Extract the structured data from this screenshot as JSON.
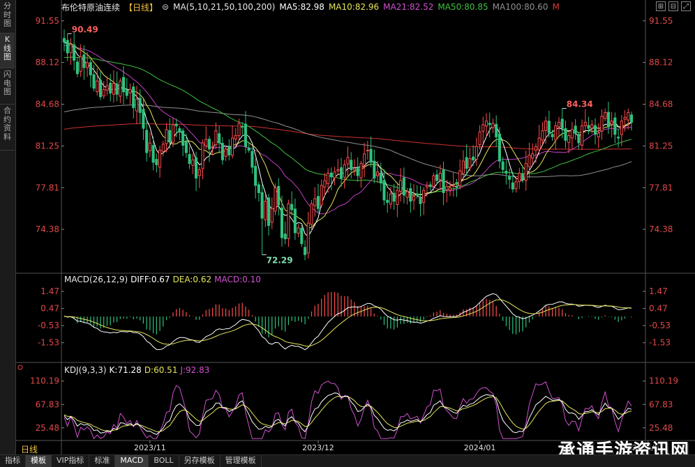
{
  "left_tabs": [
    {
      "label": "分时图",
      "active": false
    },
    {
      "label": "K线图",
      "active": true
    },
    {
      "label": "闪电图",
      "active": false
    },
    {
      "label": "合约资料",
      "active": false
    }
  ],
  "header": {
    "title": "布伦特原油连续",
    "period_tag": "【日线】",
    "ma_params": "MA(5,10,21,50,100,200)",
    "ma5": "MA5:82.98",
    "ma10": "MA10:82.96",
    "ma21": "MA21:82.52",
    "ma50": "MA50:80.85",
    "ma100": "MA100:80.60",
    "more": "M"
  },
  "price_axis_labels": [
    "91.55",
    "88.12",
    "84.68",
    "81.25",
    "77.81",
    "74.38"
  ],
  "macd_legend": {
    "params": "MACD(26,12,9)",
    "diff": "DIFF:0.67",
    "dea": "DEA:0.62",
    "macd": "MACD:0.10"
  },
  "macd_axis_labels": [
    "1.47",
    "0.47",
    "-0.53",
    "-1.53"
  ],
  "kdj_legend": {
    "params": "KDJ(9,3,3)",
    "k": "K:71.28",
    "d": "D:60.51",
    "j": "J:92.83"
  },
  "kdj_axis_labels": [
    "110.19",
    "67.83",
    "25.48"
  ],
  "date_labels": [
    "2023/11",
    "2023/12",
    "2024/01",
    "2024/02"
  ],
  "period_label": "日线",
  "bottom_tabs": [
    {
      "label": "指标",
      "active": false
    },
    {
      "label": "模板",
      "active": true
    },
    {
      "label": "VIP指标",
      "active": false
    },
    {
      "label": "标准",
      "active": false
    },
    {
      "label": "MACD",
      "active": true
    },
    {
      "label": "BOLL",
      "active": false
    },
    {
      "label": "另存模板",
      "active": false
    },
    {
      "label": "管理模板",
      "active": false
    }
  ],
  "watermark": "承通手游资讯网",
  "colors": {
    "up": "#ff4d4d",
    "down": "#2ec27e",
    "axis": "#e04848",
    "ma5": "#ffffff",
    "ma10": "#e6e65a",
    "ma21": "#c040c0",
    "ma50": "#40c040",
    "ma100": "#909090",
    "ma200": "#d03030"
  },
  "chart_data": [
    {
      "type": "candlestick",
      "ylim": [
        71.0,
        92.0
      ],
      "ticks": [
        91.55,
        88.12,
        84.68,
        81.25,
        77.81,
        74.38
      ],
      "annotations": [
        {
          "label": "90.49",
          "x_index": 1,
          "value": 90.49
        },
        {
          "label": "72.29",
          "x_index": 60,
          "value": 72.29
        },
        {
          "label": "84.34",
          "x_index": 151,
          "value": 84.34
        }
      ],
      "closes": [
        89.8,
        88.9,
        89.6,
        88.3,
        87.2,
        88.6,
        87.7,
        88.1,
        87.1,
        86.0,
        86.6,
        85.3,
        85.9,
        86.2,
        85.6,
        86.4,
        85.5,
        86.6,
        85.7,
        85.4,
        85.9,
        84.4,
        85.1,
        84.0,
        82.7,
        80.7,
        81.5,
        79.9,
        79.7,
        80.9,
        81.4,
        82.6,
        81.6,
        83.0,
        82.9,
        82.4,
        81.3,
        80.7,
        79.8,
        80.1,
        78.6,
        79.3,
        81.5,
        81.8,
        81.0,
        81.2,
        82.5,
        81.5,
        80.1,
        81.0,
        80.5,
        81.9,
        82.1,
        83.1,
        82.8,
        81.2,
        80.9,
        79.5,
        78.0,
        77.4,
        75.3,
        76.7,
        74.7,
        76.1,
        77.8,
        76.4,
        73.7,
        73.6,
        76.5,
        76.0,
        74.1,
        74.5,
        73.2,
        72.3,
        74.9,
        76.5,
        76.9,
        76.1,
        78.0,
        78.4,
        79.0,
        78.7,
        79.1,
        79.3,
        78.6,
        79.7,
        80.3,
        79.3,
        79.4,
        78.8,
        79.8,
        80.6,
        80.9,
        79.9,
        78.6,
        79.1,
        78.2,
        76.8,
        76.6,
        77.3,
        76.7,
        77.6,
        78.4,
        77.2,
        77.5,
        76.7,
        77.1,
        77.2,
        76.5,
        77.6,
        78.0,
        77.9,
        78.8,
        78.4,
        79.0,
        77.4,
        77.9,
        77.8,
        78.0,
        78.1,
        79.2,
        80.0,
        79.4,
        80.2,
        80.1,
        81.2,
        82.4,
        83.0,
        83.3,
        83.0,
        83.1,
        82.0,
        80.0,
        79.3,
        79.0,
        78.5,
        77.7,
        78.3,
        79.0,
        78.5,
        79.8,
        80.5,
        80.6,
        81.2,
        81.9,
        82.5,
        83.3,
        82.3,
        82.0,
        82.9,
        83.2,
        82.7,
        81.7,
        82.1,
        82.6,
        82.3,
        81.5,
        82.9,
        83.2,
        82.7,
        83.0,
        82.2,
        82.3,
        83.7,
        84.0,
        82.8,
        83.3,
        82.2,
        81.9,
        83.3,
        83.6,
        84.0,
        83.2
      ]
    },
    {
      "type": "macd",
      "ylim": [
        -2.6,
        2.0
      ],
      "ticks": [
        1.47,
        0.47,
        -0.53,
        -1.53
      ],
      "diff": 0.67,
      "dea": 0.62,
      "macd": 0.1
    },
    {
      "type": "kdj",
      "ylim": [
        5,
        125
      ],
      "ticks": [
        110.19,
        67.83,
        25.48
      ],
      "k": 71.28,
      "d": 60.51,
      "j": 92.83
    }
  ]
}
